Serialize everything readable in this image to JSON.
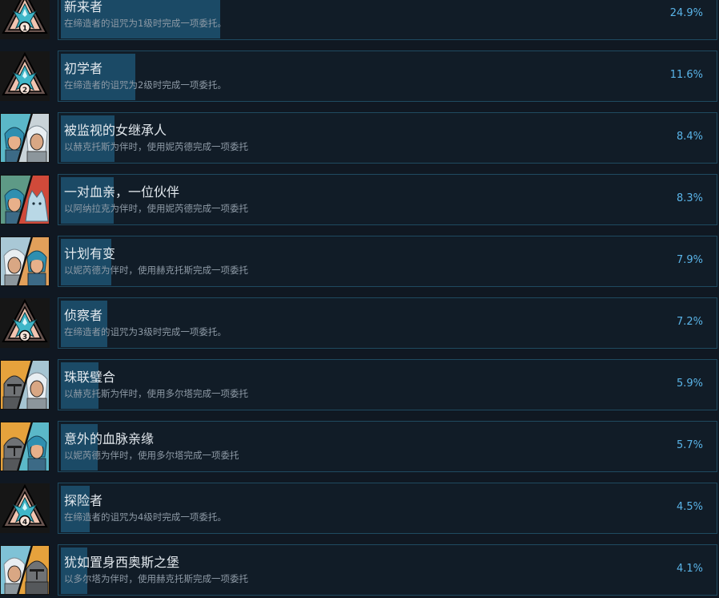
{
  "colors": {
    "background": "#101822",
    "card_border": "#1f4a60",
    "progress_fill": "#1b4a66",
    "title_text": "#e3e9ee",
    "description_text": "#8e9aa6",
    "percent_text": "#5ab4e8"
  },
  "achievements": [
    {
      "title": "新来者",
      "description": "在缔造者的诅咒为1级时完成一项委托。",
      "percent": "24.9%",
      "icon": "curse-rank-1-icon",
      "rank": "1"
    },
    {
      "title": "初学者",
      "description": "在缔造者的诅咒为2级时完成一项委托。",
      "percent": "11.6%",
      "icon": "curse-rank-2-icon",
      "rank": "2"
    },
    {
      "title": "被监视的女继承人",
      "description": "以赫克托斯为伴时，使用妮芮德完成一项委托",
      "percent": "8.4%",
      "icon": "nireid-hecktos-portrait-icon"
    },
    {
      "title": "一对血亲，一位伙伴",
      "description": "以阿纳拉克为伴时，使用妮芮德完成一项委托",
      "percent": "8.3%",
      "icon": "nireid-anarak-portrait-icon"
    },
    {
      "title": "计划有变",
      "description": "以妮芮德为伴时，使用赫克托斯完成一项委托",
      "percent": "7.9%",
      "icon": "hecktos-nireid-portrait-icon"
    },
    {
      "title": "侦察者",
      "description": "在缔造者的诅咒为3级时完成一项委托。",
      "percent": "7.2%",
      "icon": "curse-rank-3-icon",
      "rank": "3"
    },
    {
      "title": "珠联璧合",
      "description": "以赫克托斯为伴时，使用多尔塔完成一项委托",
      "percent": "5.9%",
      "icon": "dorta-hecktos-portrait-icon"
    },
    {
      "title": "意外的血脉亲缘",
      "description": "以妮芮德为伴时，使用多尔塔完成一项委托",
      "percent": "5.7%",
      "icon": "dorta-nireid-portrait-icon"
    },
    {
      "title": "探险者",
      "description": "在缔造者的诅咒为4级时完成一项委托。",
      "percent": "4.5%",
      "icon": "curse-rank-4-icon",
      "rank": "4"
    },
    {
      "title": "犹如置身西奥斯之堡",
      "description": "以多尔塔为伴时，使用赫克托斯完成一项委托",
      "percent": "4.1%",
      "icon": "hecktos-dorta-portrait-icon"
    }
  ]
}
